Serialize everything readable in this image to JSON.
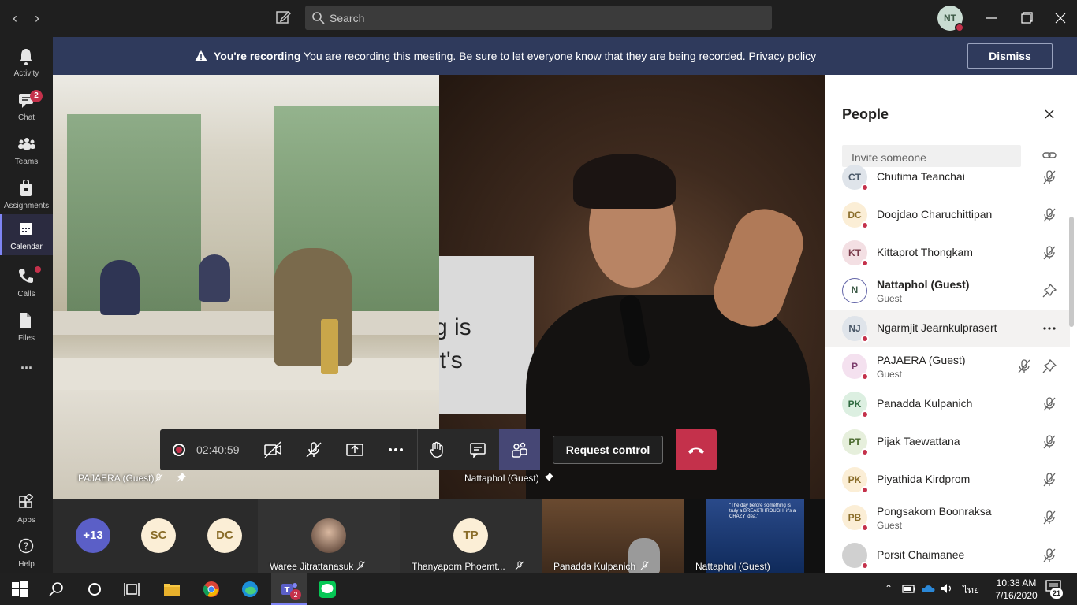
{
  "titlebar": {
    "search_placeholder": "Search",
    "user_initials": "NT"
  },
  "rail": {
    "items": [
      {
        "label": "Activity",
        "icon": "bell-icon"
      },
      {
        "label": "Chat",
        "icon": "chat-icon",
        "badge": "2"
      },
      {
        "label": "Teams",
        "icon": "teams-icon"
      },
      {
        "label": "Assignments",
        "icon": "assignments-icon"
      },
      {
        "label": "Calendar",
        "icon": "calendar-icon",
        "active": true
      },
      {
        "label": "Calls",
        "icon": "phone-icon"
      },
      {
        "label": "Files",
        "icon": "files-icon"
      }
    ],
    "more": "...",
    "apps_label": "Apps",
    "help_label": "Help"
  },
  "banner": {
    "bold": "You're recording",
    "message": " You are recording this meeting. Be sure to let everyone know that they are being recorded. ",
    "link": "Privacy policy",
    "dismiss": "Dismiss"
  },
  "stage": {
    "left_name": "PAJAERA (Guest)",
    "right_name": "Nattaphol (Guest)",
    "slide_text_line1": "g is",
    "slide_text_line2": "it's"
  },
  "controls": {
    "timer": "02:40:59",
    "request_control": "Request control"
  },
  "people": {
    "title": "People",
    "invite_placeholder": "Invite someone",
    "list": [
      {
        "initials": "CT",
        "name": "Chutima Teanchai",
        "sub": "",
        "color": "#dfe4ea",
        "fg": "#4a5868"
      },
      {
        "initials": "DC",
        "name": "Doojdao Charuchittipan",
        "sub": "",
        "color": "#fbeed6",
        "fg": "#8a6d2a"
      },
      {
        "initials": "KT",
        "name": "Kittaprot Thongkam",
        "sub": "",
        "color": "#f3dfe3",
        "fg": "#7a3b4a"
      },
      {
        "initials": "N",
        "name": "Nattaphol (Guest)",
        "sub": "Guest",
        "color": "#ffffff",
        "fg": "#3d5a47",
        "bold": true
      },
      {
        "initials": "NJ",
        "name": "Ngarmjit Jearnkulprasert",
        "sub": "",
        "color": "#dfe4ea",
        "fg": "#4a5868",
        "hover": true
      },
      {
        "initials": "P",
        "name": "PAJAERA (Guest)",
        "sub": "Guest",
        "color": "#f4e1ef",
        "fg": "#7a3a6a"
      },
      {
        "initials": "PK",
        "name": "Panadda Kulpanich",
        "sub": "",
        "color": "#dcefe1",
        "fg": "#2f6a40"
      },
      {
        "initials": "PT",
        "name": "Pijak Taewattana",
        "sub": "",
        "color": "#e6efdc",
        "fg": "#4b6a2f"
      },
      {
        "initials": "PK",
        "name": "Piyathida Kirdprom",
        "sub": "",
        "color": "#fbeed6",
        "fg": "#8a6d2a"
      },
      {
        "initials": "PB",
        "name": "Pongsakorn Boonraksa",
        "sub": "Guest",
        "color": "#fbeed6",
        "fg": "#8a6d2a"
      },
      {
        "initials": "",
        "name": "Porsit Chaimanee",
        "sub": "",
        "color": "#d0d0d0",
        "fg": "#444444"
      }
    ]
  },
  "strip": {
    "overflow": "+13",
    "tiles": [
      {
        "initials": "SC"
      },
      {
        "initials": "DC"
      },
      {
        "name": "Waree Jitrattanasuk"
      },
      {
        "initials": "TP",
        "name": "Thanyaporn Phoemt..."
      },
      {
        "name": "Panadda Kulpanich"
      },
      {
        "name": "Nattaphol (Guest)"
      }
    ],
    "slide_thumb_text": "\"The day before something is truly a BREAKTHROUGH, it's a CRAZY idea.\""
  },
  "taskbar": {
    "teams_badge": "2",
    "lang": "ไทย",
    "time": "10:38 AM",
    "date": "7/16/2020",
    "notif_count": "21"
  },
  "colors": {
    "accent": "#7f85f5",
    "danger": "#c4314b",
    "banner": "#2f3a5c"
  }
}
